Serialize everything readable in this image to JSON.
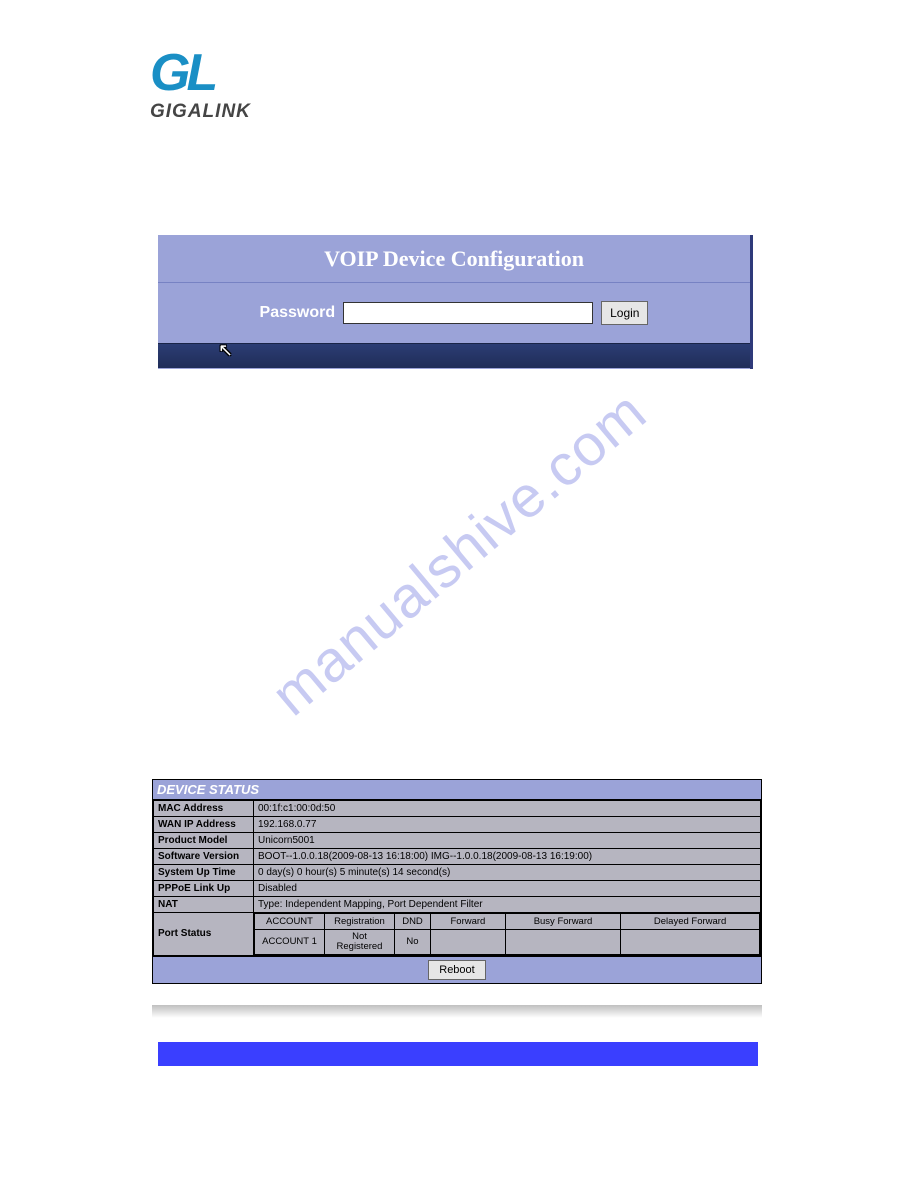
{
  "brand": {
    "logo_top": "GL",
    "logo_bottom": "GIGALINK"
  },
  "login": {
    "title": "VOIP Device Configuration",
    "password_label": "Password",
    "password_value": "",
    "login_button": "Login"
  },
  "watermark": "manualshive.com",
  "device_status": {
    "header": "DEVICE STATUS",
    "rows": {
      "mac_address": {
        "label": "MAC Address",
        "value": "00:1f:c1:00:0d:50"
      },
      "wan_ip": {
        "label": "WAN IP Address",
        "value": "192.168.0.77"
      },
      "product_model": {
        "label": "Product Model",
        "value": "Unicorn5001"
      },
      "software_version": {
        "label": "Software Version",
        "value": "BOOT--1.0.0.18(2009-08-13 16:18:00) IMG--1.0.0.18(2009-08-13 16:19:00)"
      },
      "system_up_time": {
        "label": "System Up Time",
        "value": "0 day(s) 0 hour(s) 5 minute(s) 14 second(s)"
      },
      "pppoe": {
        "label": "PPPoE Link Up",
        "value": "Disabled"
      },
      "nat": {
        "label": "NAT",
        "value": "Type: Independent Mapping, Port Dependent Filter"
      },
      "port_status": {
        "label": "Port Status",
        "headers": {
          "account": "ACCOUNT",
          "registration": "Registration",
          "dnd": "DND",
          "forward": "Forward",
          "busy_forward": "Busy Forward",
          "delayed_forward": "Delayed Forward"
        },
        "row1": {
          "account": "ACCOUNT 1",
          "registration": "Not Registered",
          "dnd": "No",
          "forward": "",
          "busy_forward": "",
          "delayed_forward": ""
        }
      }
    },
    "reboot_button": "Reboot"
  }
}
